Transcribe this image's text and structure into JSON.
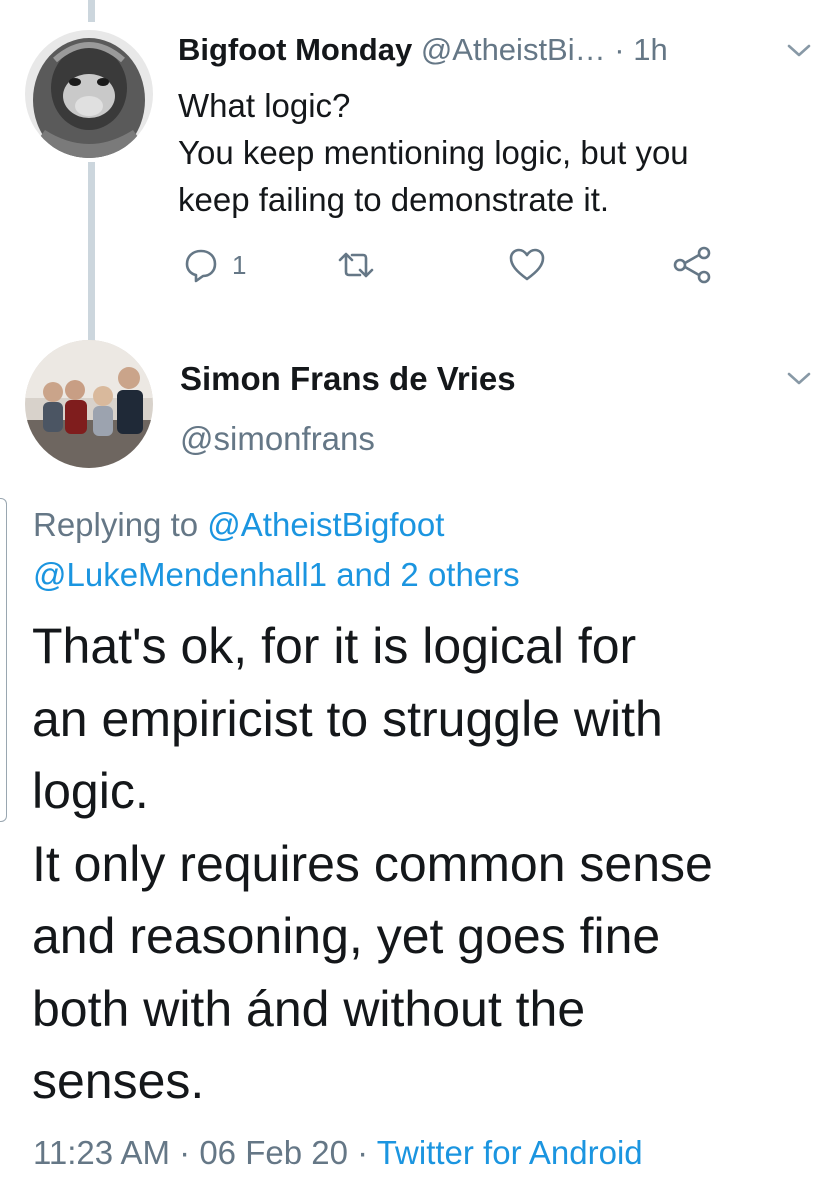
{
  "tweet1": {
    "display_name": "Bigfoot Monday",
    "handle": "@AtheistBi…",
    "separator": "·",
    "time": "1h",
    "lines": [
      "What logic?",
      "You keep mentioning logic, but you",
      "keep failing to demonstrate it."
    ],
    "reply_count": "1",
    "icons": [
      "reply-icon",
      "retweet-icon",
      "like-icon",
      "share-icon",
      "chevron-down-icon"
    ]
  },
  "tweet2": {
    "display_name": "Simon Frans de Vries",
    "handle": "@simonfrans",
    "replying_prefix": "Replying to",
    "replying_to_1": "@AtheistBigfoot",
    "replying_to_2": "@LukeMendenhall1 and 2 others",
    "body_lines": [
      "That's ok, for it is logical for",
      "an empiricist to struggle with",
      "logic.",
      "It only requires common sense",
      "and reasoning, yet goes fine",
      "both with ánd without the",
      "senses."
    ],
    "time": "11:23 AM",
    "separator": "·",
    "date": "06 Feb 20",
    "source": "Twitter for Android"
  },
  "colors": {
    "text": "#14171a",
    "secondary": "#657786",
    "link": "#1b95e0",
    "thread_line": "#ccd6dd"
  }
}
